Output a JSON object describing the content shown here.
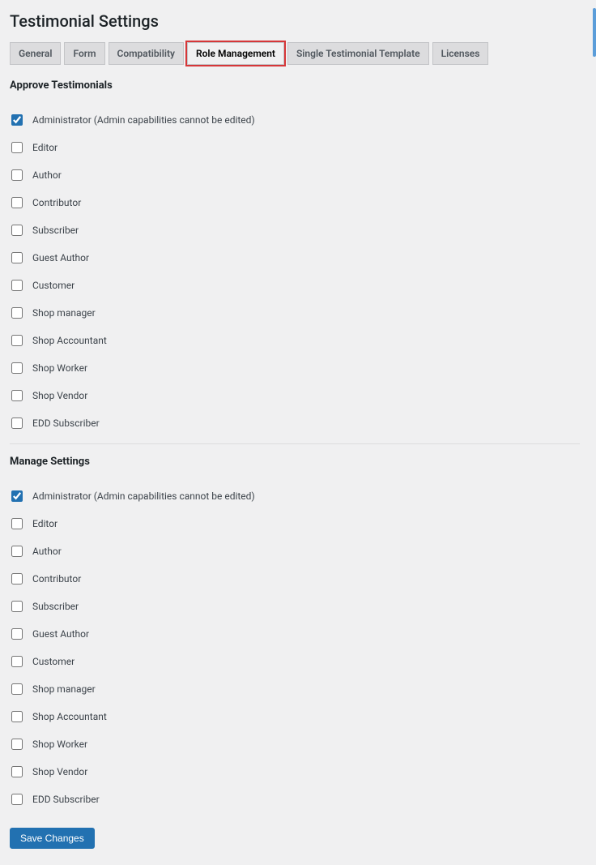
{
  "page_title": "Testimonial Settings",
  "tabs": [
    {
      "label": "General",
      "active": false
    },
    {
      "label": "Form",
      "active": false
    },
    {
      "label": "Compatibility",
      "active": false
    },
    {
      "label": "Role Management",
      "active": true
    },
    {
      "label": "Single Testimonial Template",
      "active": false
    },
    {
      "label": "Licenses",
      "active": false
    }
  ],
  "sections": [
    {
      "title": "Approve Testimonials",
      "roles": [
        {
          "label": "Administrator (Admin capabilities cannot be edited)",
          "checked": true
        },
        {
          "label": "Editor",
          "checked": false
        },
        {
          "label": "Author",
          "checked": false
        },
        {
          "label": "Contributor",
          "checked": false
        },
        {
          "label": "Subscriber",
          "checked": false
        },
        {
          "label": "Guest Author",
          "checked": false
        },
        {
          "label": "Customer",
          "checked": false
        },
        {
          "label": "Shop manager",
          "checked": false
        },
        {
          "label": "Shop Accountant",
          "checked": false
        },
        {
          "label": "Shop Worker",
          "checked": false
        },
        {
          "label": "Shop Vendor",
          "checked": false
        },
        {
          "label": "EDD Subscriber",
          "checked": false
        }
      ]
    },
    {
      "title": "Manage Settings",
      "roles": [
        {
          "label": "Administrator (Admin capabilities cannot be edited)",
          "checked": true
        },
        {
          "label": "Editor",
          "checked": false
        },
        {
          "label": "Author",
          "checked": false
        },
        {
          "label": "Contributor",
          "checked": false
        },
        {
          "label": "Subscriber",
          "checked": false
        },
        {
          "label": "Guest Author",
          "checked": false
        },
        {
          "label": "Customer",
          "checked": false
        },
        {
          "label": "Shop manager",
          "checked": false
        },
        {
          "label": "Shop Accountant",
          "checked": false
        },
        {
          "label": "Shop Worker",
          "checked": false
        },
        {
          "label": "Shop Vendor",
          "checked": false
        },
        {
          "label": "EDD Subscriber",
          "checked": false
        }
      ]
    }
  ],
  "save_button": "Save Changes"
}
